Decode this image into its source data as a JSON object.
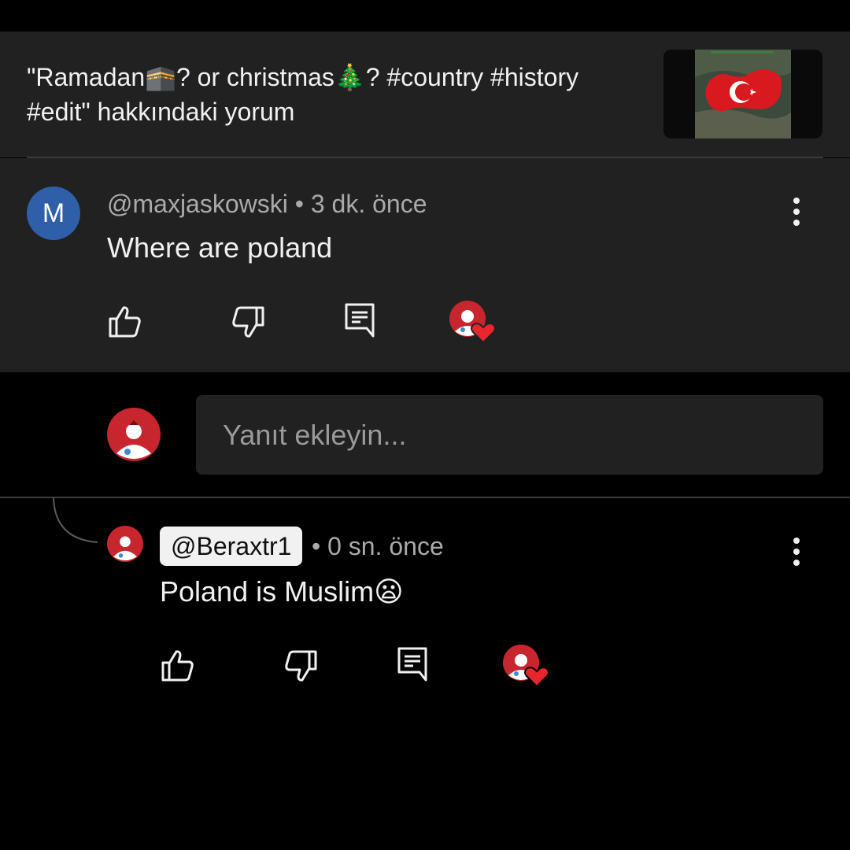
{
  "header": {
    "title_before_kaaba": "\"Ramadan",
    "kaaba_emoji": "🕋",
    "title_middle": "? or christmas",
    "tree_emoji": "🎄",
    "title_after_tree": "? #country #history",
    "title_line2": "#edit\" hakkındaki yorum",
    "thumbnail_icon": "turkey-flag-map"
  },
  "comment": {
    "avatar_letter": "M",
    "username": "@maxjaskowski",
    "separator": " • ",
    "time": "3 dk. önce",
    "text": "Where are poland",
    "actions": [
      "like-icon",
      "dislike-icon",
      "reply-icon",
      "creator-heart-icon"
    ]
  },
  "reply_box": {
    "placeholder": "Yanıt ekleyin..."
  },
  "reply": {
    "username": "@Beraxtr1",
    "separator": " • ",
    "time": "0 sn. önce",
    "text": "Poland is Muslim",
    "emoji": "😦",
    "actions": [
      "like-icon",
      "dislike-icon",
      "reply-icon",
      "creator-heart-icon"
    ]
  },
  "colors": {
    "panel": "#212121",
    "background": "#000000",
    "avatar_blue": "#2e5fa8",
    "avatar_red": "#c8262e",
    "heart": "#e8262e"
  }
}
